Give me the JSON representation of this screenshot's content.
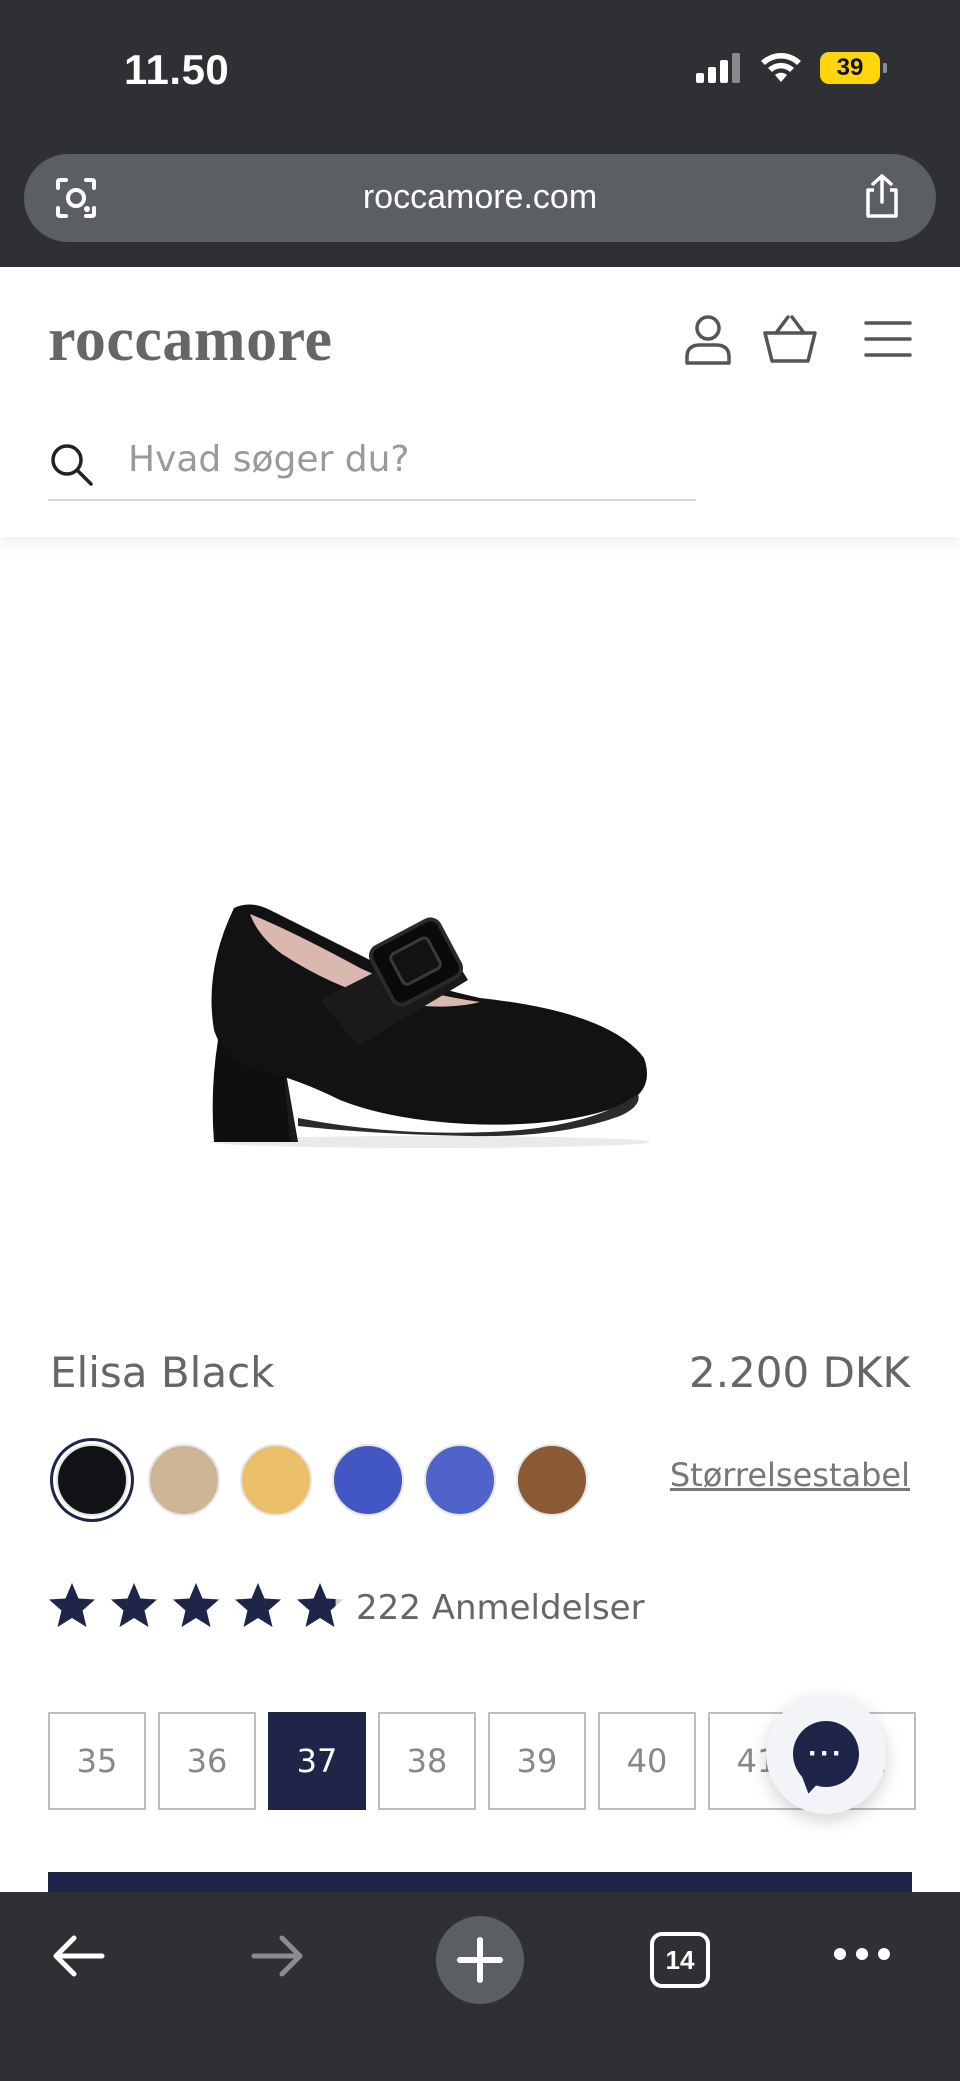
{
  "status_bar": {
    "time": "11.50",
    "battery": "39"
  },
  "browser": {
    "url": "roccamore.com",
    "tab_count": "14"
  },
  "site": {
    "logo": "roccamore",
    "search_placeholder": "Hvad søger du?"
  },
  "product": {
    "name": "Elisa Black",
    "price": "2.200 DKK",
    "size_guide": "Størrelsestabel",
    "rating": 4.8,
    "reviews": "222 Anmeldelser",
    "swatches": [
      {
        "color": "#111317",
        "selected": true
      },
      {
        "color": "#cdb497"
      },
      {
        "color": "#ecc06b"
      },
      {
        "color": "#4357c4"
      },
      {
        "color": "#4f63c8"
      },
      {
        "color": "#8a5a35"
      }
    ],
    "sizes": [
      "35",
      "36",
      "37",
      "38",
      "39",
      "40",
      "41",
      "42"
    ],
    "selected_size": "37"
  },
  "colors": {
    "navy": "#1e2548",
    "chrome": "#2e3033"
  },
  "icons": [
    "camera-lens-icon",
    "share-icon",
    "user-icon",
    "basket-icon",
    "menu-icon",
    "search-icon",
    "star-icon",
    "chat-icon",
    "back-arrow-icon",
    "forward-arrow-icon",
    "plus-icon",
    "tabs-icon",
    "more-icon"
  ]
}
